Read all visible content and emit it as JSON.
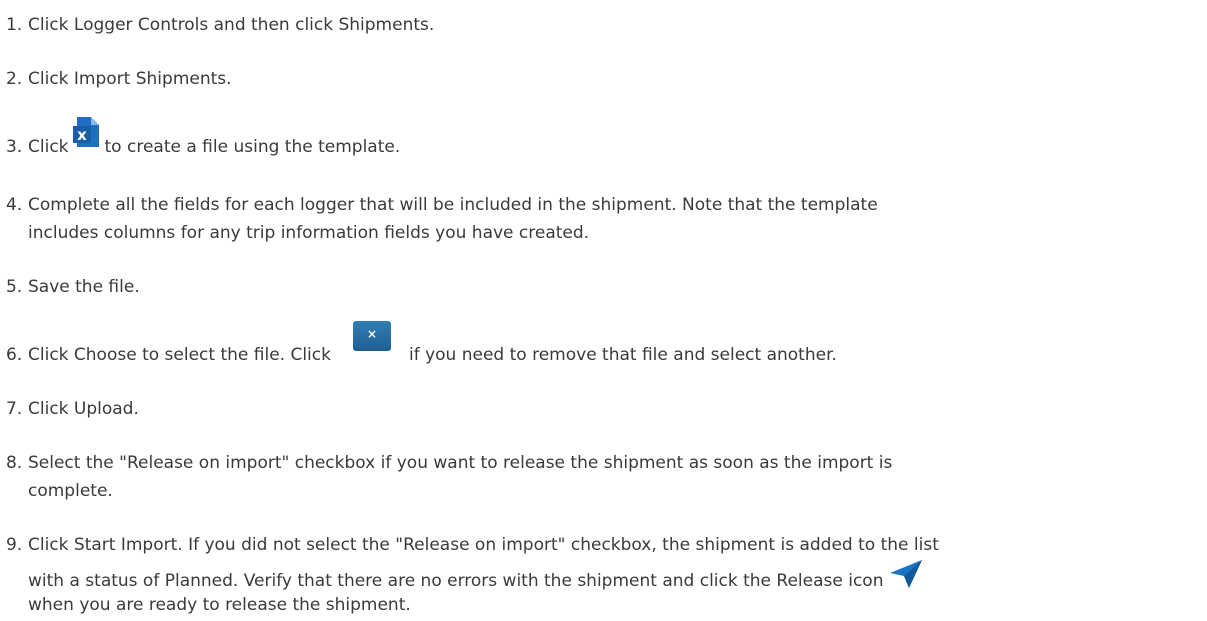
{
  "steps": [
    {
      "num": "1.",
      "text": "Click Logger Controls and then click Shipments."
    },
    {
      "num": "2.",
      "text": "Click Import Shipments."
    },
    {
      "num": "3.",
      "before": "Click",
      "icon": "excel-file-icon",
      "after": "to create a file using the template."
    },
    {
      "num": "4.",
      "line1": "Complete all the fields for each logger that will be included in the shipment. Note that the template",
      "line2": "includes columns for any trip information fields you have created."
    },
    {
      "num": "5.",
      "text": "Save the file."
    },
    {
      "num": "6.",
      "before": "Click Choose to select the file. Click",
      "icon": "remove-file-button-icon",
      "icon_glyph": "×",
      "after": "if you need to remove that file and select another."
    },
    {
      "num": "7.",
      "text": "Click Upload."
    },
    {
      "num": "8.",
      "line1": "Select the \"Release on import\" checkbox if you want to release the shipment as soon as the import is",
      "line2": "complete."
    },
    {
      "num": "9.",
      "line1": "Click Start Import. If you did not select the \"Release on import\" checkbox, the shipment is added to the list",
      "line2": "with a status of Planned. Verify that there are no errors with the shipment and click the Release icon",
      "icon": "release-paper-plane-icon",
      "line3": "when you are ready to release the shipment."
    }
  ],
  "colors": {
    "text": "#3a3a3a",
    "excel_blue": "#1e6fc0",
    "button_blue": "#2470a8",
    "release_blue": "#1a74c4"
  }
}
